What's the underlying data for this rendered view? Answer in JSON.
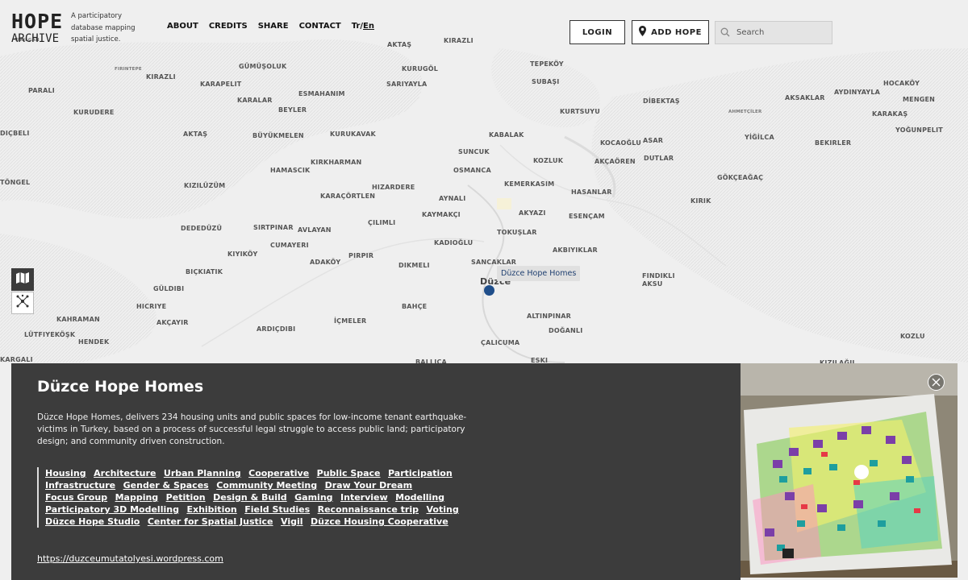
{
  "header": {
    "logo_line1": "HOPE",
    "logo_line2": "ARCHIVE",
    "tagline": "A participatory database mapping spatial justice.",
    "nav": {
      "about": "ABOUT",
      "credits": "CREDITS",
      "share": "SHARE",
      "contact": "CONTACT",
      "lang_tr": "Tr",
      "lang_sep": "/",
      "lang_en": "En"
    },
    "login_label": "LOGIN",
    "add_hope_label": "ADD HOPE",
    "search_placeholder": "Search"
  },
  "map": {
    "places": [
      "AKTAŞ",
      "KIRAZLI",
      "YIKILGAN",
      "FIRINTEPE",
      "KIRAZLI",
      "GÜMÜŞOLUK",
      "KURUGÖL",
      "TEPEKÖY",
      "SUBAŞI",
      "HOCAKÖY",
      "PARALI",
      "KARAPELIT",
      "ESMAHANIM",
      "SARIYAYLA",
      "KARALAR",
      "BEYLER",
      "AYDINYAYLA",
      "AKSAKLAR",
      "MENGEN",
      "KURUDERE",
      "KURTSUYU",
      "DİBEKTAŞ",
      "AHMETÇİLER",
      "KARAKAŞ",
      "DIÇBELI",
      "AKTAŞ",
      "BÜYÜKMELEN",
      "KURUKAVAK",
      "KABALAK",
      "YİĞİLCA",
      "YOĞUNPELIT",
      "KOCAOĞLU",
      "ASAR",
      "BEKIRLER",
      "SUNCUK",
      "DUTLAR",
      "AKÇAÖREN",
      "KIRKHARMAN",
      "KOZLUK",
      "HAMASCIK",
      "OSMANCA",
      "GÖKÇEAĞAÇ",
      "TÖNGEL",
      "KIZILÜZÜM",
      "HIZARDERE",
      "KEMERKASIM",
      "HASANLAR",
      "KARAÇÖRTLEN",
      "AYNALI",
      "KIRIK",
      "KAYMAKÇI",
      "AKYAZI",
      "ESENÇAM",
      "DEDEDÜZÜ",
      "SIRTPINAR",
      "AVLAYAN",
      "ÇILIMLI",
      "TOKUŞLAR",
      "CUMAYERI",
      "KADIOĞLU",
      "AKBIYIKLAR",
      "KIYIKÖY",
      "PIRPIR",
      "ADAKÖY",
      "DIKMELI",
      "SANCAKLAR",
      "BIÇKIATIK",
      "FINDIKLI AKSU",
      "GÜLDIBI",
      "Düzce",
      "BAHÇE",
      "HICRIYE",
      "KAHRAMAN",
      "AKÇAYIR",
      "ALTINPINAR",
      "ARDIÇDIBI",
      "İÇMELER",
      "DOĞANLI",
      "LÜTFIYEKÖŞK",
      "HENDEK",
      "KOZLU",
      "ÇALICUMA",
      "KARGALI",
      "BALLICA",
      "ESKI",
      "KIZILAĞIL"
    ],
    "marker_label": "Düzce Hope Homes",
    "layer_icon": "map-icon",
    "network_icon": "network-icon"
  },
  "panel": {
    "title": "Düzce Hope Homes",
    "description": "Düzce Hope Homes, delivers 234 housing units and public spaces for low-income tenant earthquake-victims in Turkey, based on a process of successful legal struggle to access public land; participatory design; and community driven construction.",
    "tags": [
      "Housing",
      "Architecture",
      "Urban Planning",
      "Cooperative",
      "Public Space",
      "Participation",
      "Infrastructure",
      "Gender & Spaces",
      "Community Meeting",
      "Draw Your Dream",
      "Focus Group",
      "Mapping",
      "Petition",
      "Design & Build",
      "Gaming",
      "Interview",
      "Modelling",
      "Participatory 3D Modelling",
      "Exhibition",
      "Field Studies",
      "Reconnaissance trip",
      "Voting",
      "Düzce Hope Studio",
      "Center for Spatial Justice",
      "Vigil",
      "Düzce Housing Cooperative"
    ],
    "link": "https://duzceumutatolyesi.wordpress.com",
    "close_icon": "close-icon"
  },
  "colors": {
    "marker": "#1f4e8a",
    "panel_bg": "#3c3c3c",
    "map_bg": "#efefef"
  }
}
